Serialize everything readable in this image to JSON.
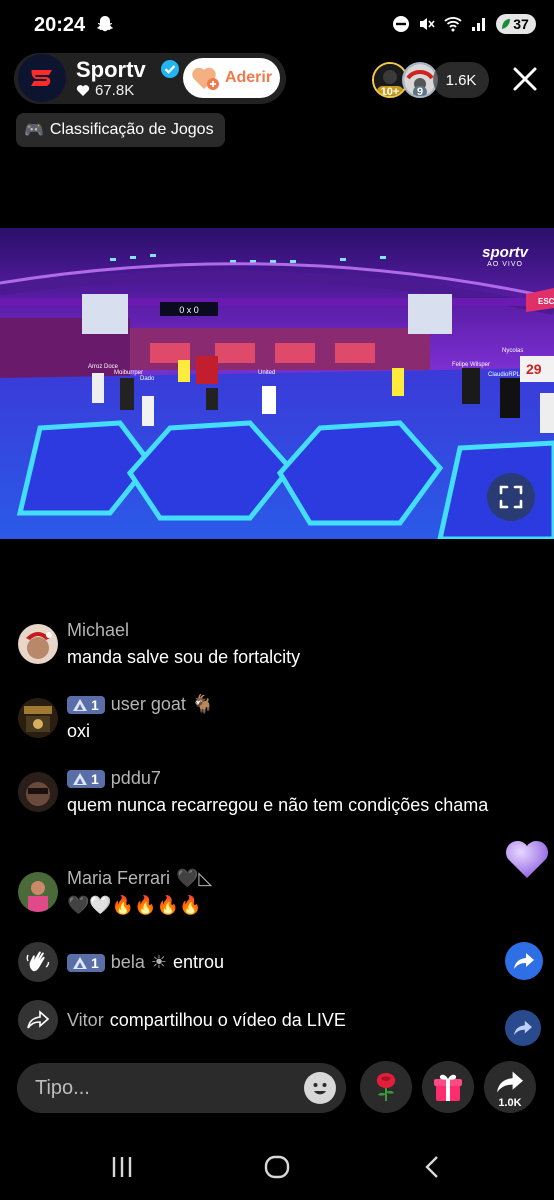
{
  "status_bar": {
    "time": "20:24",
    "battery": "37"
  },
  "host": {
    "name": "Sportv",
    "likes": "67.8K",
    "join_label": "Aderir"
  },
  "viewers": {
    "top1_rank": "10+",
    "top2_rank": "9",
    "count": "1.6K"
  },
  "category": {
    "emoji": "🎮",
    "label": "Classificação de Jogos"
  },
  "video": {
    "watermark_logo": "sportv",
    "watermark_sub": "AO VIVO",
    "scoreboard": "0 x 0",
    "player_tags": [
      "Arroz Doce",
      "Moiburrper",
      "Dado",
      "United",
      "Nycolas",
      "Felipe Wilsper",
      "ClaudioRPLays"
    ],
    "right_sign": "29",
    "right_banner": "ESC"
  },
  "chat": [
    {
      "user": "Michael",
      "level": null,
      "suffix": "",
      "text": "manda salve sou de fortalcity",
      "avatar_color": "#b9876a"
    },
    {
      "user": "user goat",
      "level": "1",
      "suffix": "🐐",
      "text": "oxi",
      "avatar_color": "#4a3a20"
    },
    {
      "user": "pddu7",
      "level": "1",
      "suffix": "",
      "text": "quem nunca recarregou e não tem condições chama",
      "avatar_color": "#6a4a3a"
    },
    {
      "user": "Maria Ferrari",
      "level": null,
      "suffix": "🖤◺",
      "text": "🖤🤍🔥🔥🔥🔥",
      "avatar_color": "#3e5a3e"
    }
  ],
  "join_event": {
    "level": "1",
    "user": "bela",
    "emoji": "☀",
    "text": "entrou"
  },
  "share_event": {
    "user": "Vitor",
    "text": "compartilhou o vídeo da LIVE"
  },
  "input": {
    "placeholder": "Tipo..."
  },
  "actions": {
    "share_count": "1.0K"
  },
  "colors": {
    "join_text": "#f07a4a",
    "level_badge": "#5a6fa8",
    "share_blue": "#2f6fe6"
  }
}
